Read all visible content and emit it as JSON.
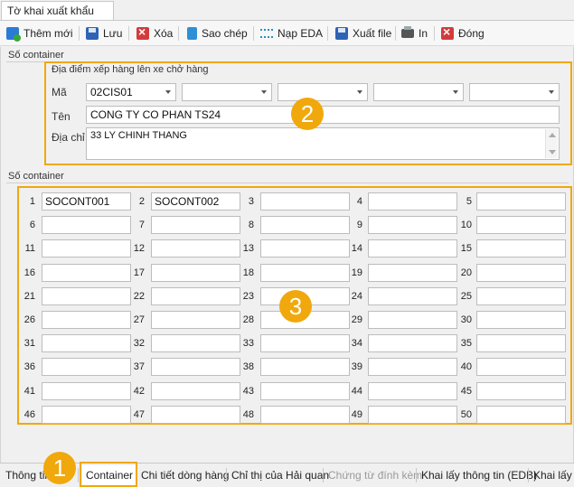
{
  "window_tab": "Tờ khai xuất khẩu",
  "toolbar": {
    "add_label": "Thêm mới",
    "save_label": "Lưu",
    "delete_label": "Xóa",
    "copy_label": "Sao chép",
    "eda_label": "Nạp EDA",
    "export_label": "Xuất file",
    "print_label": "In",
    "close_label": "Đóng"
  },
  "section_top": {
    "title": "Số container",
    "loading_place": {
      "title": "Địa điểm xếp hàng lên xe chở hàng",
      "code_label": "Mã",
      "code_values": [
        "02CIS01",
        "",
        "",
        "",
        ""
      ],
      "name_label": "Tên",
      "name_value": "CONG TY CO PHAN TS24",
      "address_label": "Địa chỉ",
      "address_value": "33 LY CHINH THANG"
    }
  },
  "section_containers": {
    "title": "Số container",
    "containers": [
      {
        "no": "1",
        "value": "SOCONT001"
      },
      {
        "no": "2",
        "value": "SOCONT002"
      },
      {
        "no": "3",
        "value": ""
      },
      {
        "no": "4",
        "value": ""
      },
      {
        "no": "5",
        "value": ""
      },
      {
        "no": "6",
        "value": ""
      },
      {
        "no": "7",
        "value": ""
      },
      {
        "no": "8",
        "value": ""
      },
      {
        "no": "9",
        "value": ""
      },
      {
        "no": "10",
        "value": ""
      },
      {
        "no": "11",
        "value": ""
      },
      {
        "no": "12",
        "value": ""
      },
      {
        "no": "13",
        "value": ""
      },
      {
        "no": "14",
        "value": ""
      },
      {
        "no": "15",
        "value": ""
      },
      {
        "no": "16",
        "value": ""
      },
      {
        "no": "17",
        "value": ""
      },
      {
        "no": "18",
        "value": ""
      },
      {
        "no": "19",
        "value": ""
      },
      {
        "no": "20",
        "value": ""
      },
      {
        "no": "21",
        "value": ""
      },
      {
        "no": "22",
        "value": ""
      },
      {
        "no": "23",
        "value": ""
      },
      {
        "no": "24",
        "value": ""
      },
      {
        "no": "25",
        "value": ""
      },
      {
        "no": "26",
        "value": ""
      },
      {
        "no": "27",
        "value": ""
      },
      {
        "no": "28",
        "value": ""
      },
      {
        "no": "29",
        "value": ""
      },
      {
        "no": "30",
        "value": ""
      },
      {
        "no": "31",
        "value": ""
      },
      {
        "no": "32",
        "value": ""
      },
      {
        "no": "33",
        "value": ""
      },
      {
        "no": "34",
        "value": ""
      },
      {
        "no": "35",
        "value": ""
      },
      {
        "no": "36",
        "value": ""
      },
      {
        "no": "37",
        "value": ""
      },
      {
        "no": "38",
        "value": ""
      },
      {
        "no": "39",
        "value": ""
      },
      {
        "no": "40",
        "value": ""
      },
      {
        "no": "41",
        "value": ""
      },
      {
        "no": "42",
        "value": ""
      },
      {
        "no": "43",
        "value": ""
      },
      {
        "no": "44",
        "value": ""
      },
      {
        "no": "45",
        "value": ""
      },
      {
        "no": "46",
        "value": ""
      },
      {
        "no": "47",
        "value": ""
      },
      {
        "no": "48",
        "value": ""
      },
      {
        "no": "49",
        "value": ""
      },
      {
        "no": "50",
        "value": ""
      }
    ]
  },
  "callouts": {
    "badge_1": "1",
    "badge_2": "2",
    "badge_3": "3",
    "color": "#f0a80c"
  },
  "bottom_tabs": [
    {
      "label": "Thông tin",
      "state": "normal"
    },
    {
      "label": "Container",
      "state": "active"
    },
    {
      "label": "Chi tiết dòng hàng",
      "state": "normal"
    },
    {
      "label": "Chỉ thị của Hải quan",
      "state": "normal"
    },
    {
      "label": "Chứng từ đính kèm",
      "state": "disabled"
    },
    {
      "label": "Khai lấy thông tin (EDB)",
      "state": "normal"
    },
    {
      "label": "Khai lấy",
      "state": "normal"
    }
  ]
}
